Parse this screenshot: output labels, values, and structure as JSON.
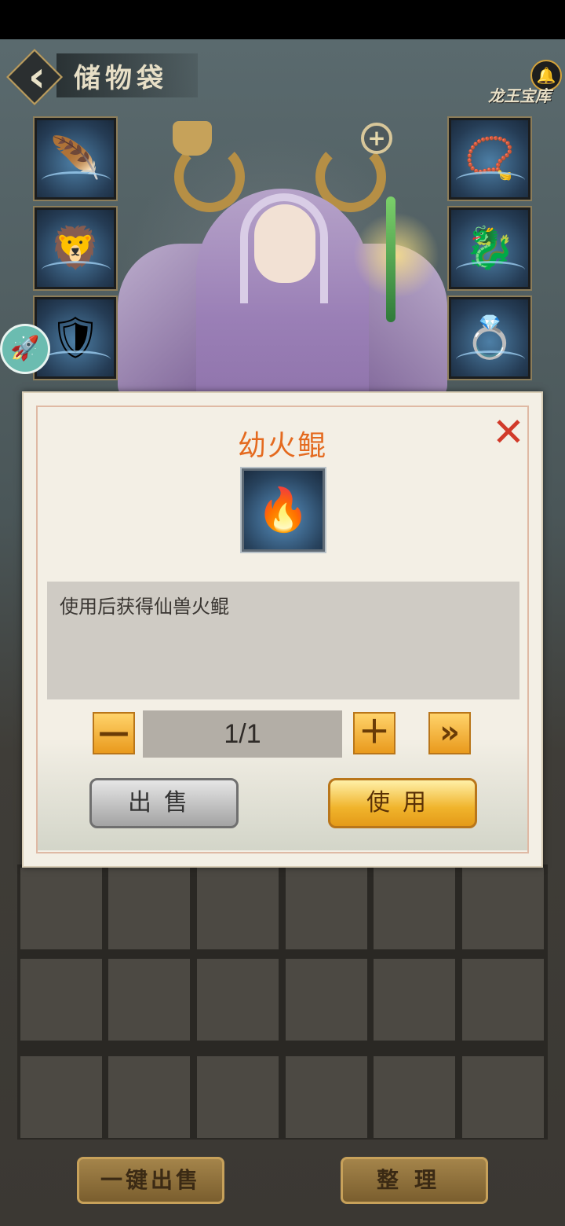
{
  "header": {
    "title": "储物袋",
    "back_icon": "chevron-left-icon",
    "event_label": "龙王宝库",
    "bell_icon": "bell-icon"
  },
  "equipment": {
    "left_slots": [
      {
        "icon": "hat-icon",
        "glyph": "🪶"
      },
      {
        "icon": "helmet-icon",
        "glyph": "🦁"
      },
      {
        "icon": "armor-icon",
        "glyph": "🛡"
      }
    ],
    "right_slots": [
      {
        "icon": "bracelet-icon",
        "glyph": "📿"
      },
      {
        "icon": "pendant-icon",
        "glyph": "🐉"
      },
      {
        "icon": "ring-icon",
        "glyph": "💍"
      }
    ]
  },
  "dialog": {
    "item_name": "幼火鲲",
    "item_icon": "fire-fish-icon",
    "description": "使用后获得仙兽火鲲",
    "quantity": "1/1",
    "minus_label": "—",
    "plus_label": "＋",
    "max_label": "»",
    "sell_label": "出售",
    "use_label": "使用",
    "close_label": "✕"
  },
  "bottom": {
    "sell_all_label": "一键出售",
    "sort_label": "整理"
  },
  "colors": {
    "title_orange": "#e46a1f",
    "use_button": "#f0b42c",
    "close_red": "#d13a2a"
  }
}
